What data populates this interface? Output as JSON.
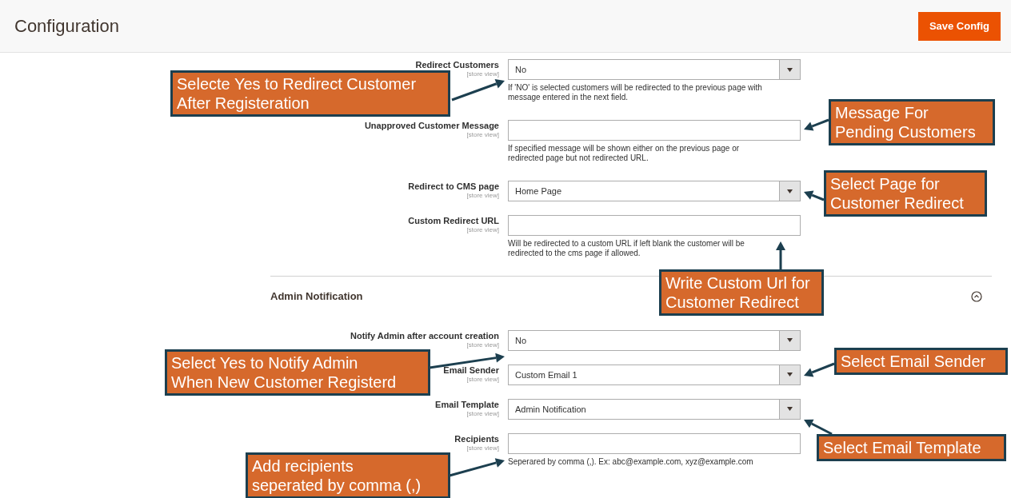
{
  "header": {
    "title": "Configuration",
    "save_button": "Save Config"
  },
  "groups": [
    {
      "fields": [
        {
          "label": "Redirect Customers",
          "scope": "[store view]",
          "kind": "select",
          "value": "No",
          "note": "If 'NO' is selected customers will be redirected to the previous page with message entered in the next field."
        },
        {
          "label": "Unapproved Customer Message",
          "scope": "[store view]",
          "kind": "text",
          "note": "If specified message will be shown either on the previous page or redirected page but not redirected URL."
        },
        {
          "label": "Redirect to CMS page",
          "scope": "[store view]",
          "kind": "select",
          "value": "Home Page"
        },
        {
          "label": "Custom Redirect URL",
          "scope": "[store view]",
          "kind": "text",
          "note": "Will be redirected to a custom URL if left blank the customer will be redirected to the cms page if allowed."
        }
      ]
    },
    {
      "title": "Admin Notification",
      "expanded": true,
      "fields": [
        {
          "label": "Notify Admin after account creation",
          "scope": "[store view]",
          "kind": "select",
          "value": "No"
        },
        {
          "label": "Email Sender",
          "scope": "[store view]",
          "kind": "select",
          "value": "Custom Email 1"
        },
        {
          "label": "Email Template",
          "scope": "[store view]",
          "kind": "select",
          "value": "Admin Notification"
        },
        {
          "label": "Recipients",
          "scope": "[store view]",
          "kind": "text",
          "note": "Seperared by comma (,). Ex: abc@example.com, xyz@example.com"
        }
      ]
    }
  ],
  "callouts": [
    {
      "lines": [
        "Selecte Yes to Redirect Customer",
        "After Registeration"
      ]
    },
    {
      "lines": [
        "Message For",
        "Pending Customers"
      ]
    },
    {
      "lines": [
        "Select Page for",
        "Customer Redirect"
      ]
    },
    {
      "lines": [
        "Write Custom Url for",
        "Customer Redirect"
      ]
    },
    {
      "lines": [
        "Select Yes to Notify Admin",
        "When New Customer Registerd"
      ]
    },
    {
      "lines": [
        "Select Email Sender"
      ]
    },
    {
      "lines": [
        "Select Email Template"
      ]
    },
    {
      "lines": [
        "Add recipients",
        "seperated by comma (,)"
      ]
    }
  ]
}
